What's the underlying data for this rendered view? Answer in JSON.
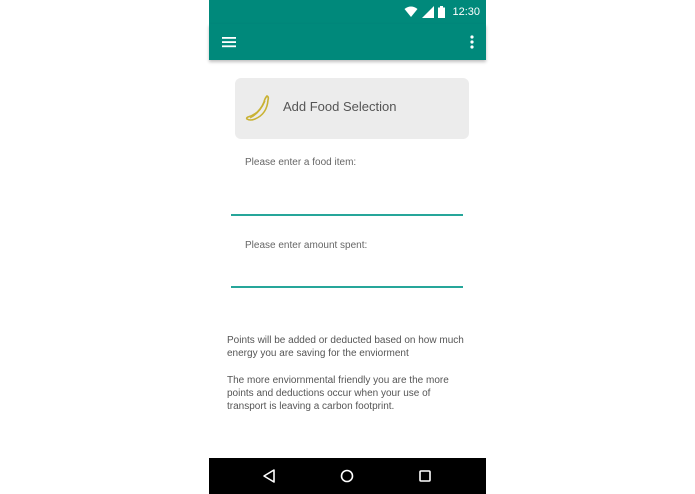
{
  "status_bar": {
    "time": "12:30",
    "icons": [
      "wifi-icon",
      "cell-signal-icon",
      "battery-icon"
    ]
  },
  "app_bar": {
    "menu_icon": "hamburger-menu-icon",
    "overflow_icon": "more-vert-icon",
    "color": "#00897b"
  },
  "add_card": {
    "icon": "banana-icon",
    "label": "Add Food Selection"
  },
  "form": {
    "food_item_label": "Please enter a food item:",
    "food_item_value": "",
    "amount_label": "Please enter amount spent:",
    "amount_value": ""
  },
  "info": {
    "paragraph_1": "Points will be added or deducted based on how much energy you are saving for the enviorment",
    "paragraph_2": "The more enviornmental friendly you are the more points and deductions occur when your use of transport is leaving a carbon footprint."
  },
  "nav_bar": {
    "back_icon": "back-triangle-icon",
    "home_icon": "home-circle-icon",
    "recents_icon": "recents-square-icon"
  },
  "colors": {
    "primary": "#00897b",
    "accent_underline": "#26a69a",
    "banana": "#c9b233"
  }
}
